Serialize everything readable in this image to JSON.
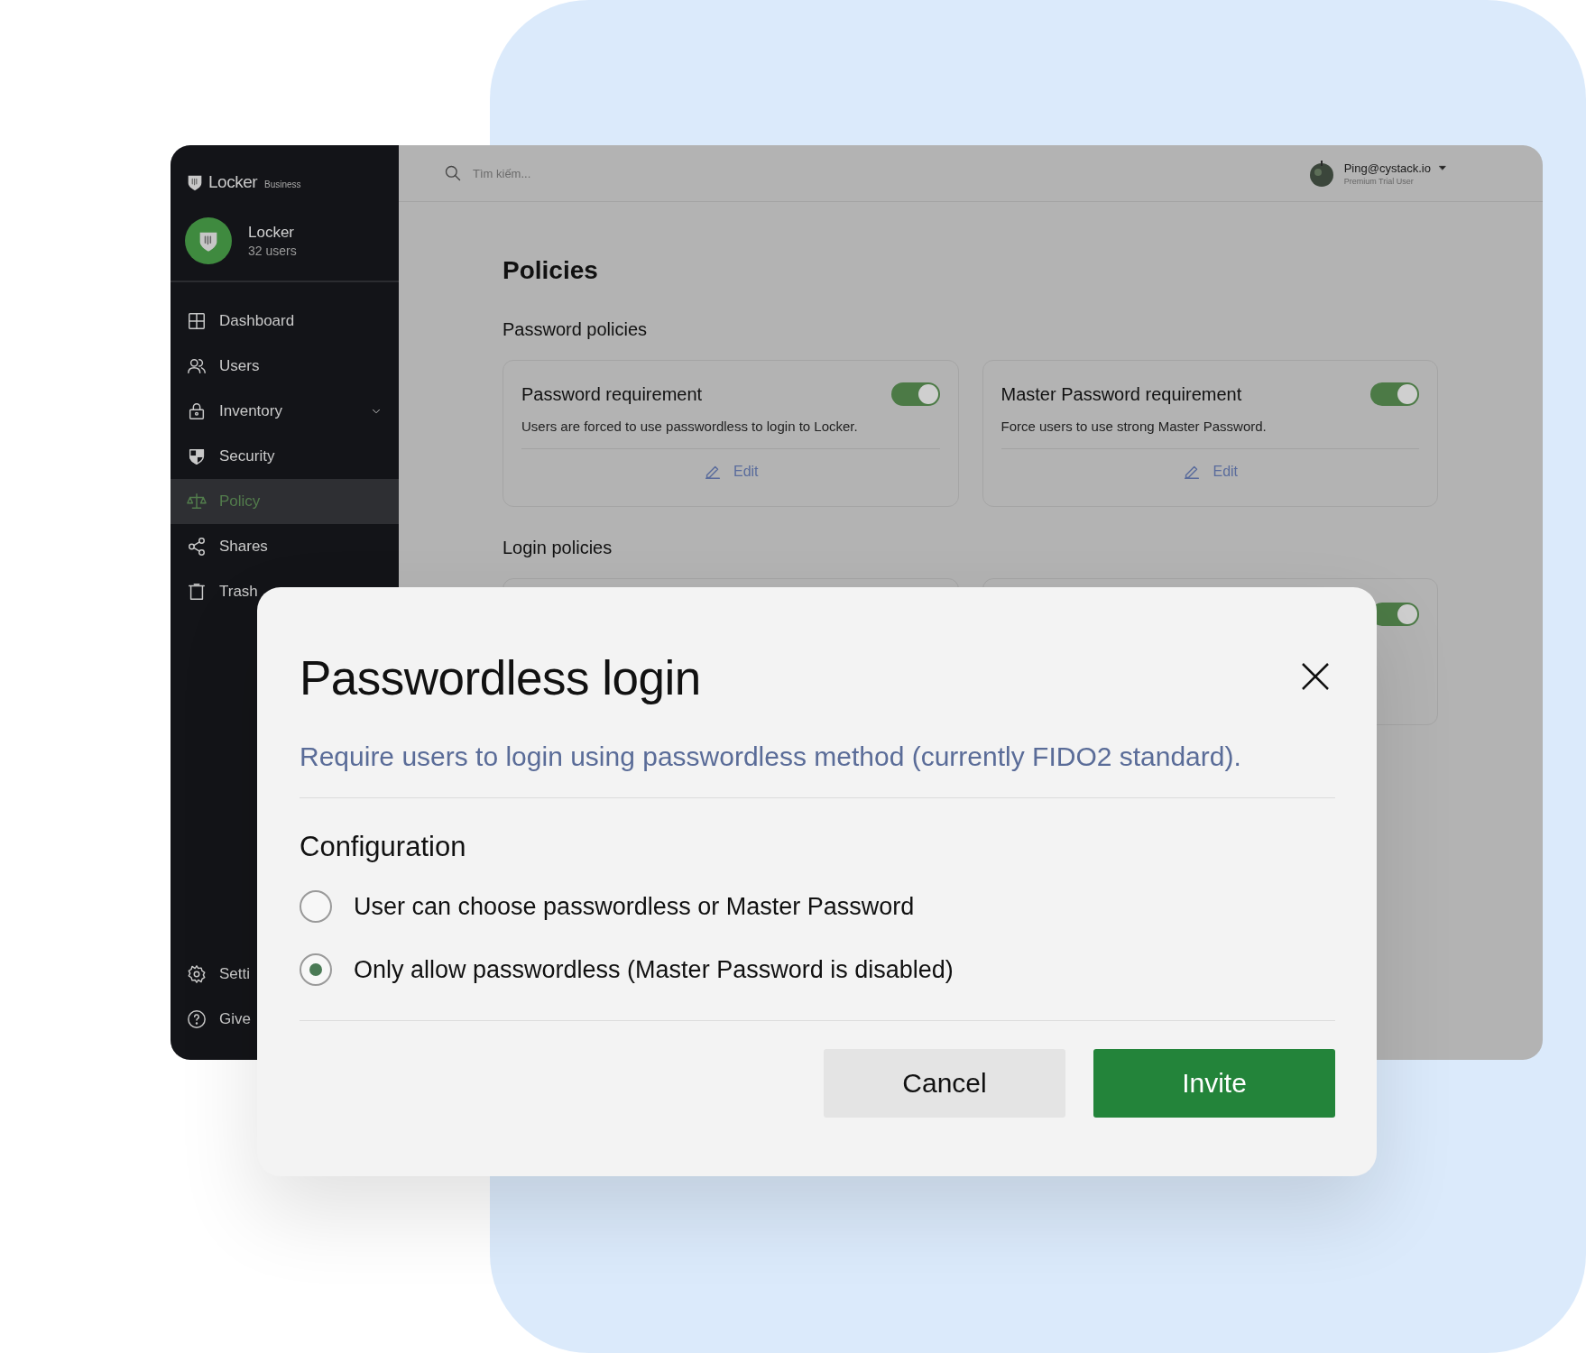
{
  "sidebar": {
    "brand": "Locker",
    "brand_tag": "Business",
    "org": {
      "name": "Locker",
      "users": "32 users"
    },
    "items": [
      {
        "label": "Dashboard",
        "selected": false
      },
      {
        "label": "Users",
        "selected": false
      },
      {
        "label": "Inventory",
        "selected": false,
        "expanded": false
      },
      {
        "label": "Security",
        "selected": false
      },
      {
        "label": "Policy",
        "selected": true
      },
      {
        "label": "Shares",
        "selected": false
      },
      {
        "label": "Trash",
        "selected": false
      }
    ],
    "footer_items": [
      {
        "label": "Setti"
      },
      {
        "label": "Give"
      }
    ]
  },
  "topbar": {
    "search": {
      "placeholder": "Tìm kiếm..."
    },
    "user": {
      "name": "Ping@cystack.io",
      "plan": "Premium Trial User"
    }
  },
  "page": {
    "title": "Policies",
    "sections": [
      {
        "title": "Password policies",
        "cards": [
          {
            "kind": "full",
            "title": "Password requirement",
            "description": "Users are forced to use passwordless to login to Locker.",
            "on": true,
            "action": "Edit"
          },
          {
            "kind": "full",
            "title": "Master Password requirement",
            "description": "Force users to use strong Master Password.",
            "on": true,
            "action": "Edit"
          }
        ]
      },
      {
        "title": "Login policies",
        "cards": [
          {
            "kind": "blank"
          },
          {
            "kind": "toggle_only",
            "on": true
          }
        ]
      }
    ]
  },
  "dialog": {
    "title": "Passwordless login",
    "description": "Require users to login using passwordless method (currently FIDO2 standard).",
    "section": "Configuration",
    "options": [
      {
        "label": "User can choose passwordless or Master Password",
        "selected": false
      },
      {
        "label": "Only allow passwordless (Master Password is disabled)",
        "selected": true
      }
    ],
    "buttons": [
      {
        "label": "Cancel",
        "kind": "secondary"
      },
      {
        "label": "Invite",
        "kind": "primary"
      }
    ]
  }
}
